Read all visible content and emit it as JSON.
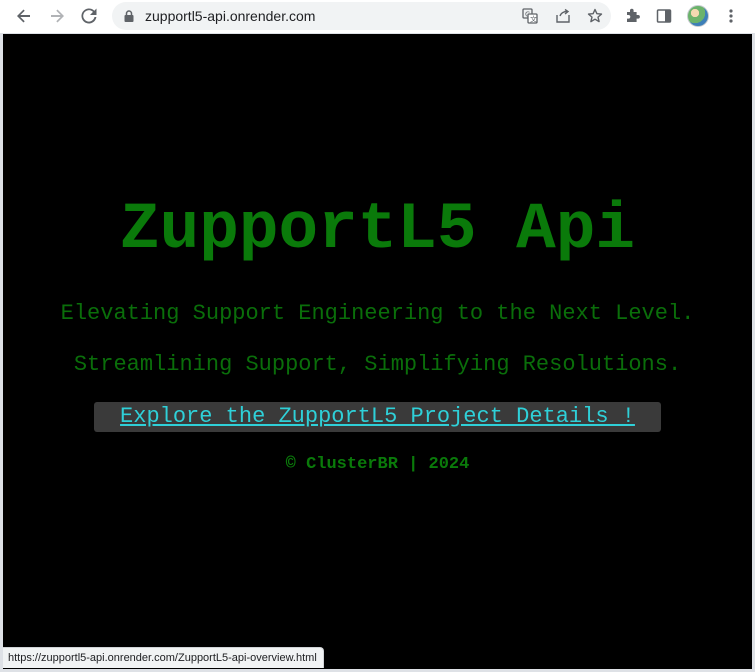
{
  "browser": {
    "url": "zupportl5-api.onrender.com",
    "status_url": "https://zupportl5-api.onrender.com/ZupportL5-api-overview.html",
    "icons": {
      "back": "arrow-left-icon",
      "forward": "arrow-right-icon",
      "reload": "reload-icon",
      "lock": "lock-icon",
      "translate": "translate-icon",
      "share": "share-icon",
      "bookmark": "star-icon",
      "extensions": "puzzle-icon",
      "side_panel": "side-panel-icon",
      "menu": "kebab-menu-icon"
    }
  },
  "page": {
    "title": "ZupportL5 Api",
    "tagline_1": "Elevating Support Engineering to the Next Level.",
    "tagline_2": "Streamlining Support, Simplifying Resolutions.",
    "project_link": "Explore the ZupportL5 Project Details !",
    "footer": "© ClusterBR | 2024"
  },
  "colors": {
    "page_background": "#000000",
    "title_green": "#0a7a0a",
    "tagline_green": "#0a6e0a",
    "link_cyan": "#2fd0d8",
    "link_background": "#3a3a3a"
  }
}
